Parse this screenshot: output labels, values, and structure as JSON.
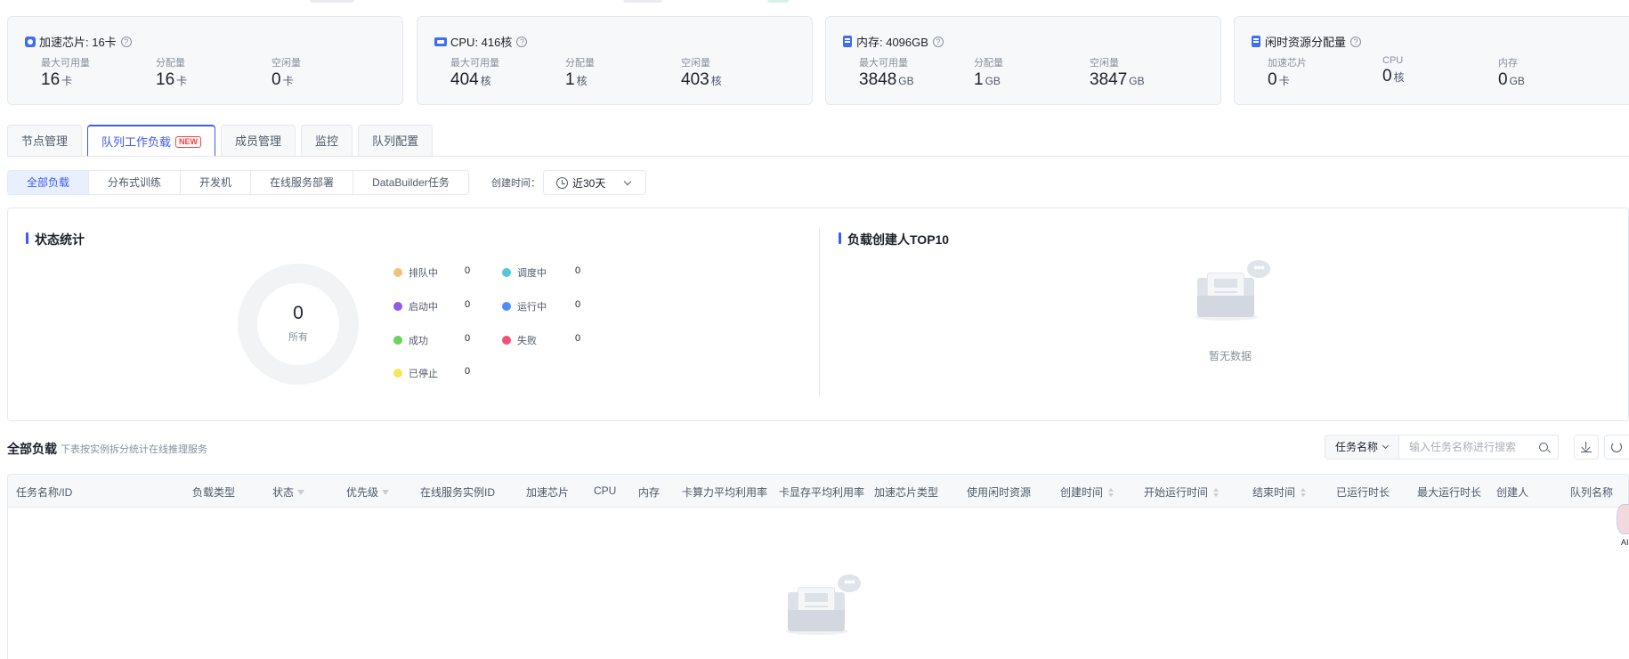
{
  "resources": [
    {
      "title": "加速芯片: 16卡",
      "icon": "chip-icon",
      "stats": [
        {
          "label": "最大可用量",
          "value": "16",
          "unit": "卡"
        },
        {
          "label": "分配量",
          "value": "16",
          "unit": "卡"
        },
        {
          "label": "空闲量",
          "value": "0",
          "unit": "卡"
        }
      ]
    },
    {
      "title": "CPU: 416核",
      "icon": "cpu-icon",
      "stats": [
        {
          "label": "最大可用量",
          "value": "404",
          "unit": "核"
        },
        {
          "label": "分配量",
          "value": "1",
          "unit": "核"
        },
        {
          "label": "空闲量",
          "value": "403",
          "unit": "核"
        }
      ]
    },
    {
      "title": "内存: 4096GB",
      "icon": "memory-icon",
      "stats": [
        {
          "label": "最大可用量",
          "value": "3848",
          "unit": "GB"
        },
        {
          "label": "分配量",
          "value": "1",
          "unit": "GB"
        },
        {
          "label": "空闲量",
          "value": "3847",
          "unit": "GB"
        }
      ]
    },
    {
      "title": "闲时资源分配量",
      "icon": "memory-icon",
      "stats": [
        {
          "label": "加速芯片",
          "value": "0",
          "unit": "卡"
        },
        {
          "label": "CPU",
          "value": "0",
          "unit": "核"
        },
        {
          "label": "内存",
          "value": "0",
          "unit": "GB"
        }
      ]
    }
  ],
  "help_glyph": "?",
  "tabs": [
    {
      "label": "节点管理",
      "active": false
    },
    {
      "label": "队列工作负载",
      "active": true,
      "badge": "NEW"
    },
    {
      "label": "成员管理",
      "active": false
    },
    {
      "label": "监控",
      "active": false
    },
    {
      "label": "队列配置",
      "active": false
    }
  ],
  "workload_filters": [
    {
      "label": "全部负载",
      "active": true
    },
    {
      "label": "分布式训练",
      "active": false
    },
    {
      "label": "开发机",
      "active": false
    },
    {
      "label": "在线服务部署",
      "active": false
    },
    {
      "label": "DataBuilder任务",
      "active": false
    }
  ],
  "created_time": {
    "label": "创建时间：",
    "value": "近30天"
  },
  "status_stats": {
    "title": "状态统计",
    "total_value": "0",
    "total_label": "所有",
    "legend": [
      {
        "label": "排队中",
        "count": "0",
        "color": "#f0c27a"
      },
      {
        "label": "调度中",
        "count": "0",
        "color": "#52c8d6"
      },
      {
        "label": "启动中",
        "count": "0",
        "color": "#8f5ae8"
      },
      {
        "label": "运行中",
        "count": "0",
        "color": "#4e8ef7"
      },
      {
        "label": "成功",
        "count": "0",
        "color": "#6cd160"
      },
      {
        "label": "失败",
        "count": "0",
        "color": "#f0507a"
      },
      {
        "label": "已停止",
        "count": "0",
        "color": "#f3e65a"
      }
    ]
  },
  "top_creators": {
    "title": "负载创建人TOP10",
    "empty_text": "暂无数据",
    "bubble_glyph": "•••"
  },
  "list": {
    "title": "全部负载",
    "subtitle": "下表按实例拆分统计在线推理服务",
    "search_type": "任务名称",
    "search_placeholder": "输入任务名称进行搜索"
  },
  "columns": [
    {
      "label": "任务名称/ID"
    },
    {
      "label": "负载类型"
    },
    {
      "label": "状态",
      "filter": true
    },
    {
      "label": "优先级",
      "filter": true
    },
    {
      "label": "在线服务实例ID"
    },
    {
      "label": "加速芯片"
    },
    {
      "label": "CPU"
    },
    {
      "label": "内存"
    },
    {
      "label": "卡算力平均利用率"
    },
    {
      "label": "卡显存平均利用率"
    },
    {
      "label": "加速芯片类型"
    },
    {
      "label": "使用闲时资源"
    },
    {
      "label": "创建时间",
      "sort": true
    },
    {
      "label": "开始运行时间",
      "sort": true
    },
    {
      "label": "结束时间",
      "sort": true
    },
    {
      "label": "已运行时长"
    },
    {
      "label": "最大运行时长"
    },
    {
      "label": "创建人"
    },
    {
      "label": "队列名称"
    }
  ],
  "assistant": {
    "label": "AI"
  }
}
